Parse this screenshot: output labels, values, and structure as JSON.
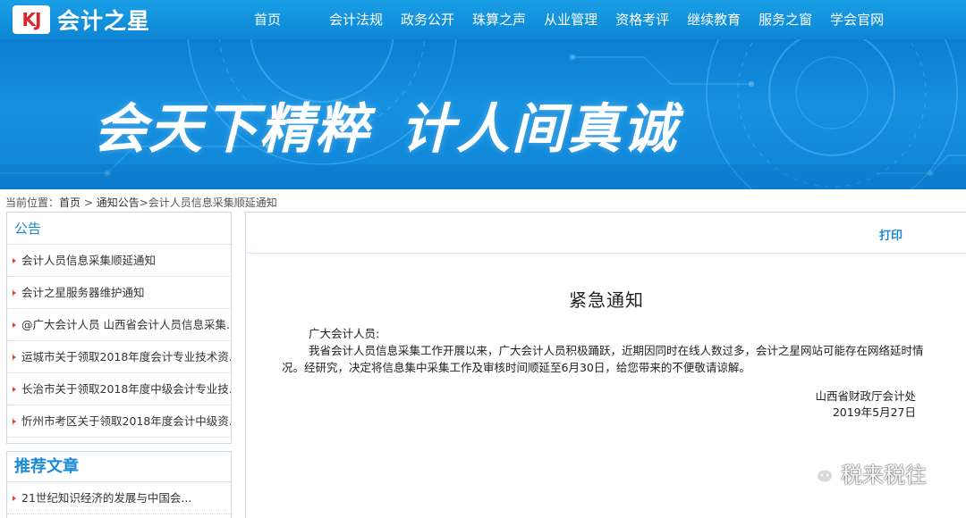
{
  "logo": {
    "mark": "KJ",
    "name": "会计之星"
  },
  "nav": [
    {
      "label": "首页"
    },
    {
      "label": "会计法规"
    },
    {
      "label": "政务公开"
    },
    {
      "label": "珠算之声"
    },
    {
      "label": "从业管理"
    },
    {
      "label": "资格考评"
    },
    {
      "label": "继续教育"
    },
    {
      "label": "服务之窗"
    },
    {
      "label": "学会官网"
    }
  ],
  "banner": {
    "slogan_left": "会天下精粹",
    "slogan_right": "计人间真诚"
  },
  "breadcrumb": {
    "prefix": "当前位置：",
    "home": "首页",
    "sep1": " > ",
    "section": "通知公告",
    "rest": ">会计人员信息采集顺延通知"
  },
  "sidebar": {
    "notice_title": "公告",
    "notices": [
      {
        "label": "会计人员信息采集顺延通知"
      },
      {
        "label": "会计之星服务器维护通知"
      },
      {
        "label": "@广大会计人员 山西省会计人员信息采集..."
      },
      {
        "label": "运城市关于领取2018年度会计专业技术资..."
      },
      {
        "label": "长治市关于领取2018年度中级会计专业技..."
      },
      {
        "label": "忻州市考区关于领取2018年度会计中级资..."
      }
    ],
    "recommend_title": "推荐文章",
    "recommends": [
      {
        "label": "21世纪知识经济的发展与中国会..."
      }
    ]
  },
  "article": {
    "print_label": "打印",
    "title": "紧急通知",
    "salutation": "广大会计人员:",
    "body": "我省会计人员信息采集工作开展以来，广大会计人员积极踊跃，近期因同时在线人数过多，会计之星网站可能存在网络延时情况。经研究，决定将信息集中采集工作及审核时间顺延至6月30日，给您带来的不便敬请谅解。",
    "signature": "山西省财政厅会计处",
    "date": "2019年5月27日"
  },
  "watermark": {
    "text": "税来税往"
  },
  "colors": {
    "header": "#1a9fe6",
    "accent": "#1b8ad6",
    "bullet": "#e2462a"
  }
}
